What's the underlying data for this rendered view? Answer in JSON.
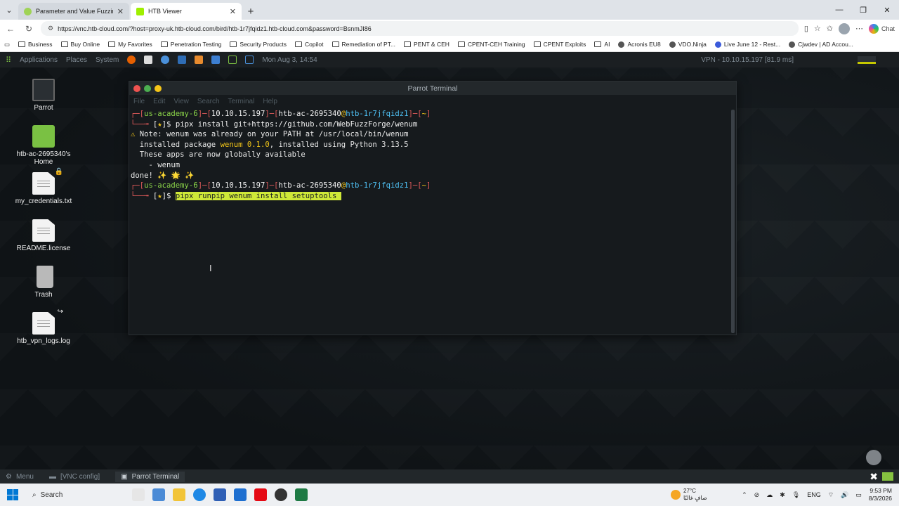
{
  "browser": {
    "tabs": [
      {
        "title": "Parameter and Value Fuzzing | Ha",
        "active": false
      },
      {
        "title": "HTB Viewer",
        "active": true
      }
    ],
    "url": "https://vnc.htb-cloud.com/?host=proxy-uk.htb-cloud.com/bird/htb-1r7jfqidz1.htb-cloud.com&password=BsnmJI86",
    "chat_label": "Chat",
    "bookmarks": [
      "Business",
      "Buy Online",
      "My Favorites",
      "Penetration Testing",
      "Security Products",
      "Copilot",
      "Remediation of PT...",
      "PENT & CEH",
      "CPENT-CEH Training",
      "CPENT Exploits",
      "AI",
      "Acronis EU8",
      "VDO.Ninja",
      "Live June 12 - Rest...",
      "Cjwdev | AD Accou..."
    ]
  },
  "parrot": {
    "panel": {
      "applications": "Applications",
      "places": "Places",
      "system": "System",
      "datetime": "Mon Aug 3, 14:54",
      "vpn": "VPN - 10.10.15.197 [81.9 ms]"
    },
    "desktop_icons": [
      {
        "label": "Parrot",
        "kind": "monitor"
      },
      {
        "label": "htb-ac-2695340's Home",
        "kind": "folder"
      },
      {
        "label": "my_credentials.txt",
        "kind": "file"
      },
      {
        "label": "README.license",
        "kind": "file"
      },
      {
        "label": "Trash",
        "kind": "trash"
      },
      {
        "label": "htb_vpn_logs.log",
        "kind": "file"
      }
    ],
    "terminal": {
      "title": "Parrot Terminal",
      "menu": [
        "File",
        "Edit",
        "View",
        "Search",
        "Terminal",
        "Help"
      ],
      "prompt": {
        "user": "us-academy-6",
        "ip": "10.10.15.197",
        "host_user": "htb-ac-2695340",
        "host": "htb-1r7jfqidz1",
        "dir": "~"
      },
      "cmd1": "pipx install git+https://github.com/WebFuzzForge/wenum",
      "note": " Note: wenum was already on your PATH at /usr/local/bin/wenum",
      "installed_prefix": "  installed package ",
      "installed_pkg": "wenum 0.1.0",
      "installed_suffix": ", installed using Python 3.13.5",
      "apps_line": "  These apps are now globally available",
      "app_item": "    - wenum",
      "done": "done! ✨ 🌟 ✨",
      "cmd2": "pipx runpip wenum install setuptools"
    },
    "bottom_panel": {
      "menu": "Menu",
      "vnc": "[VNC config]",
      "terminal_task": "Parrot Terminal"
    }
  },
  "taskbar": {
    "search": "Search",
    "weather_temp": "27°C",
    "weather_desc": "صافٍ غالبًا",
    "lang": "ENG",
    "time": "9:53 PM",
    "date": "8/3/2026"
  }
}
